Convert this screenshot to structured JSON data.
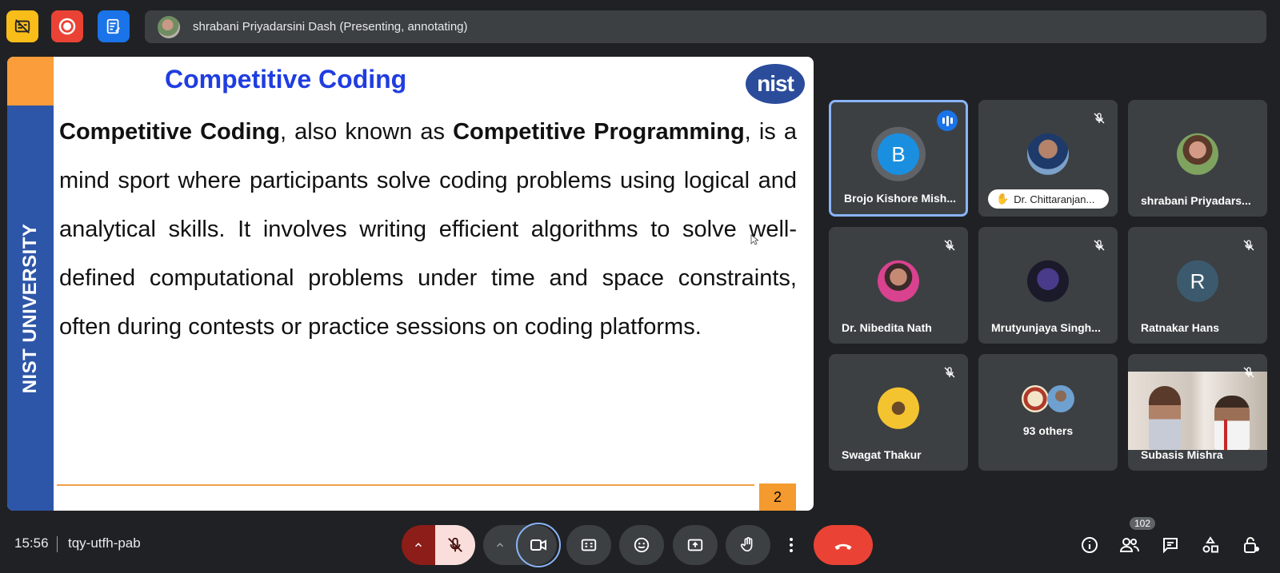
{
  "topbar": {
    "icons": [
      "captions-off-icon",
      "record-icon",
      "notes-icon"
    ],
    "presenter_text": "shrabani Priyadarsini Dash (Presenting, annotating)"
  },
  "slide": {
    "title": "Competitive Coding",
    "side_label": "NIST UNIVERSITY",
    "logo_text": "nist",
    "body": {
      "t1": "Competitive Coding",
      "t2": ", also known as ",
      "t3": "Competitive Programming",
      "t4": ", is a mind sport where participants solve coding problems using logical and analytical skills. It involves writing efficient algorithms to solve well-defined computational problems under time and space constraints, often during contests or practice sessions on coding platforms."
    },
    "page_number": "2"
  },
  "participants": [
    {
      "name": "Brojo Kishore Mish...",
      "initial": "B",
      "avatar_color": "#1a8fe0",
      "speaking": true
    },
    {
      "name": "Dr. Chittaranjan...",
      "hand_raised": true
    },
    {
      "name": "shrabani Priyadars..."
    },
    {
      "name": "Dr. Nibedita Nath"
    },
    {
      "name": "Mrutyunjaya Singh..."
    },
    {
      "name": "Ratnakar Hans",
      "initial": "R",
      "avatar_color": "#3c5a6e"
    },
    {
      "name": "Swagat Thakur"
    },
    {
      "name": "93 others"
    },
    {
      "name": "Subasis Mishra",
      "video": true
    }
  ],
  "bottombar": {
    "time": "15:56",
    "meeting_code": "tqy-utfh-pab",
    "people_count": "102"
  },
  "colors": {
    "background": "#202124",
    "tile": "#3c4043",
    "accent": "#8ab4f8",
    "end_call": "#ea4335"
  }
}
